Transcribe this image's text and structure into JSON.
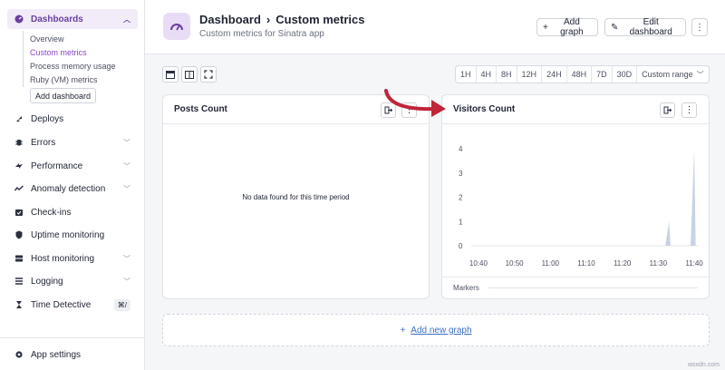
{
  "sidebar": {
    "dashboards": "Dashboards",
    "sub": [
      "Overview",
      "Custom metrics",
      "Process memory usage",
      "Ruby (VM) metrics"
    ],
    "add_dashboard": "Add dashboard",
    "items": [
      "Deploys",
      "Errors",
      "Performance",
      "Anomaly detection",
      "Check-ins",
      "Uptime monitoring",
      "Host monitoring",
      "Logging",
      "Time Detective"
    ],
    "time_detective_shortcut": "⌘/",
    "app_settings": "App settings"
  },
  "header": {
    "crumb_root": "Dashboard",
    "crumb_sep": "›",
    "crumb_current": "Custom metrics",
    "subtitle": "Custom metrics for Sinatra app",
    "add_graph": "Add graph",
    "edit_dashboard": "Edit dashboard"
  },
  "toolbar": {
    "ranges": [
      "1H",
      "4H",
      "8H",
      "12H",
      "24H",
      "48H",
      "7D",
      "30D"
    ],
    "custom_range": "Custom range"
  },
  "panels": {
    "posts": {
      "title": "Posts Count",
      "empty": "No data found for this time period"
    },
    "visitors": {
      "title": "Visitors Count",
      "markers": "Markers"
    }
  },
  "chart_data": {
    "type": "area",
    "x": [
      "10:40",
      "10:50",
      "11:00",
      "11:10",
      "11:20",
      "11:30",
      "11:40"
    ],
    "series": [
      {
        "values": [
          0,
          0,
          0,
          0,
          0,
          0,
          0
        ],
        "spikes": [
          {
            "at": "11:33",
            "value": 1
          },
          {
            "at": "11:40",
            "value": 4
          }
        ]
      }
    ],
    "ylim": [
      0,
      4
    ],
    "yticks": [
      "0",
      "1",
      "2",
      "3",
      "4"
    ],
    "color": "#c8d2e6"
  },
  "add_new_graph": "Add new graph",
  "watermark": "wsxdn.com"
}
